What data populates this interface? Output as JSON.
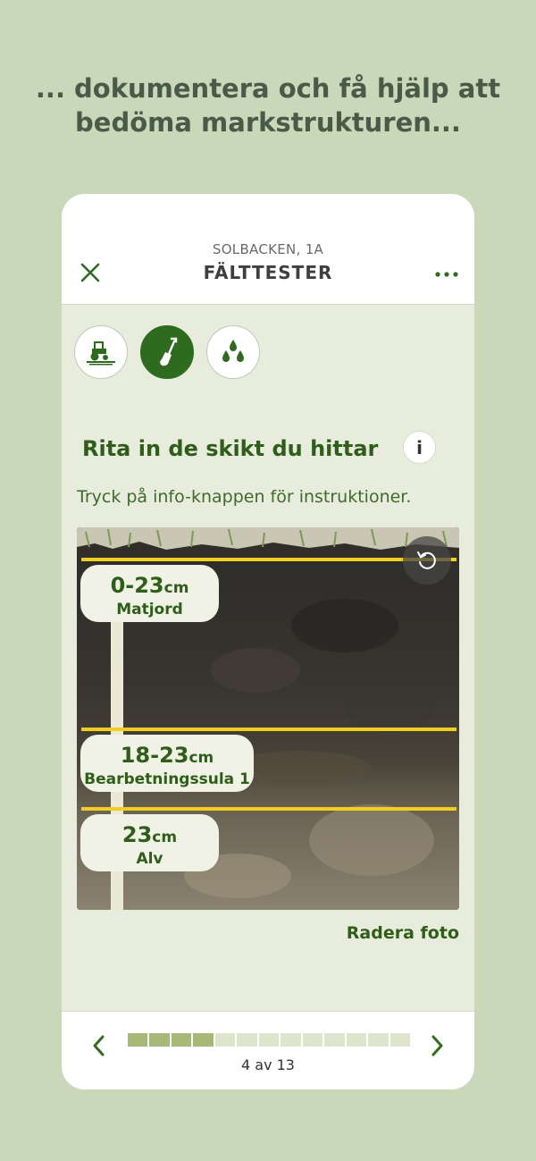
{
  "headline": "... dokumentera och få hjälp att bedöma markstrukturen...",
  "header": {
    "subtitle": "SOLBACKEN, 1A",
    "title": "FÄLTTESTER"
  },
  "modes": [
    {
      "icon": "tractor-icon",
      "active": false
    },
    {
      "icon": "shovel-icon",
      "active": true
    },
    {
      "icon": "water-drops-icon",
      "active": false
    }
  ],
  "section": {
    "title": "Rita in de skikt du hittar",
    "info_label": "i",
    "hint": "Tryck på info-knappen för instruktioner."
  },
  "layers": [
    {
      "range": "0-23",
      "unit": "cm",
      "name": "Matjord"
    },
    {
      "range": "18-23",
      "unit": "cm",
      "name": "Bearbetningssula 1"
    },
    {
      "range": "23",
      "unit": "cm",
      "name": "Alv"
    }
  ],
  "delete_photo": "Radera foto",
  "pager": {
    "current": 4,
    "total": 13,
    "label": "4 av 13"
  },
  "colors": {
    "brand_green": "#2f6b1f",
    "layer_line": "#f2cf1f",
    "background": "#c8d8b8"
  }
}
